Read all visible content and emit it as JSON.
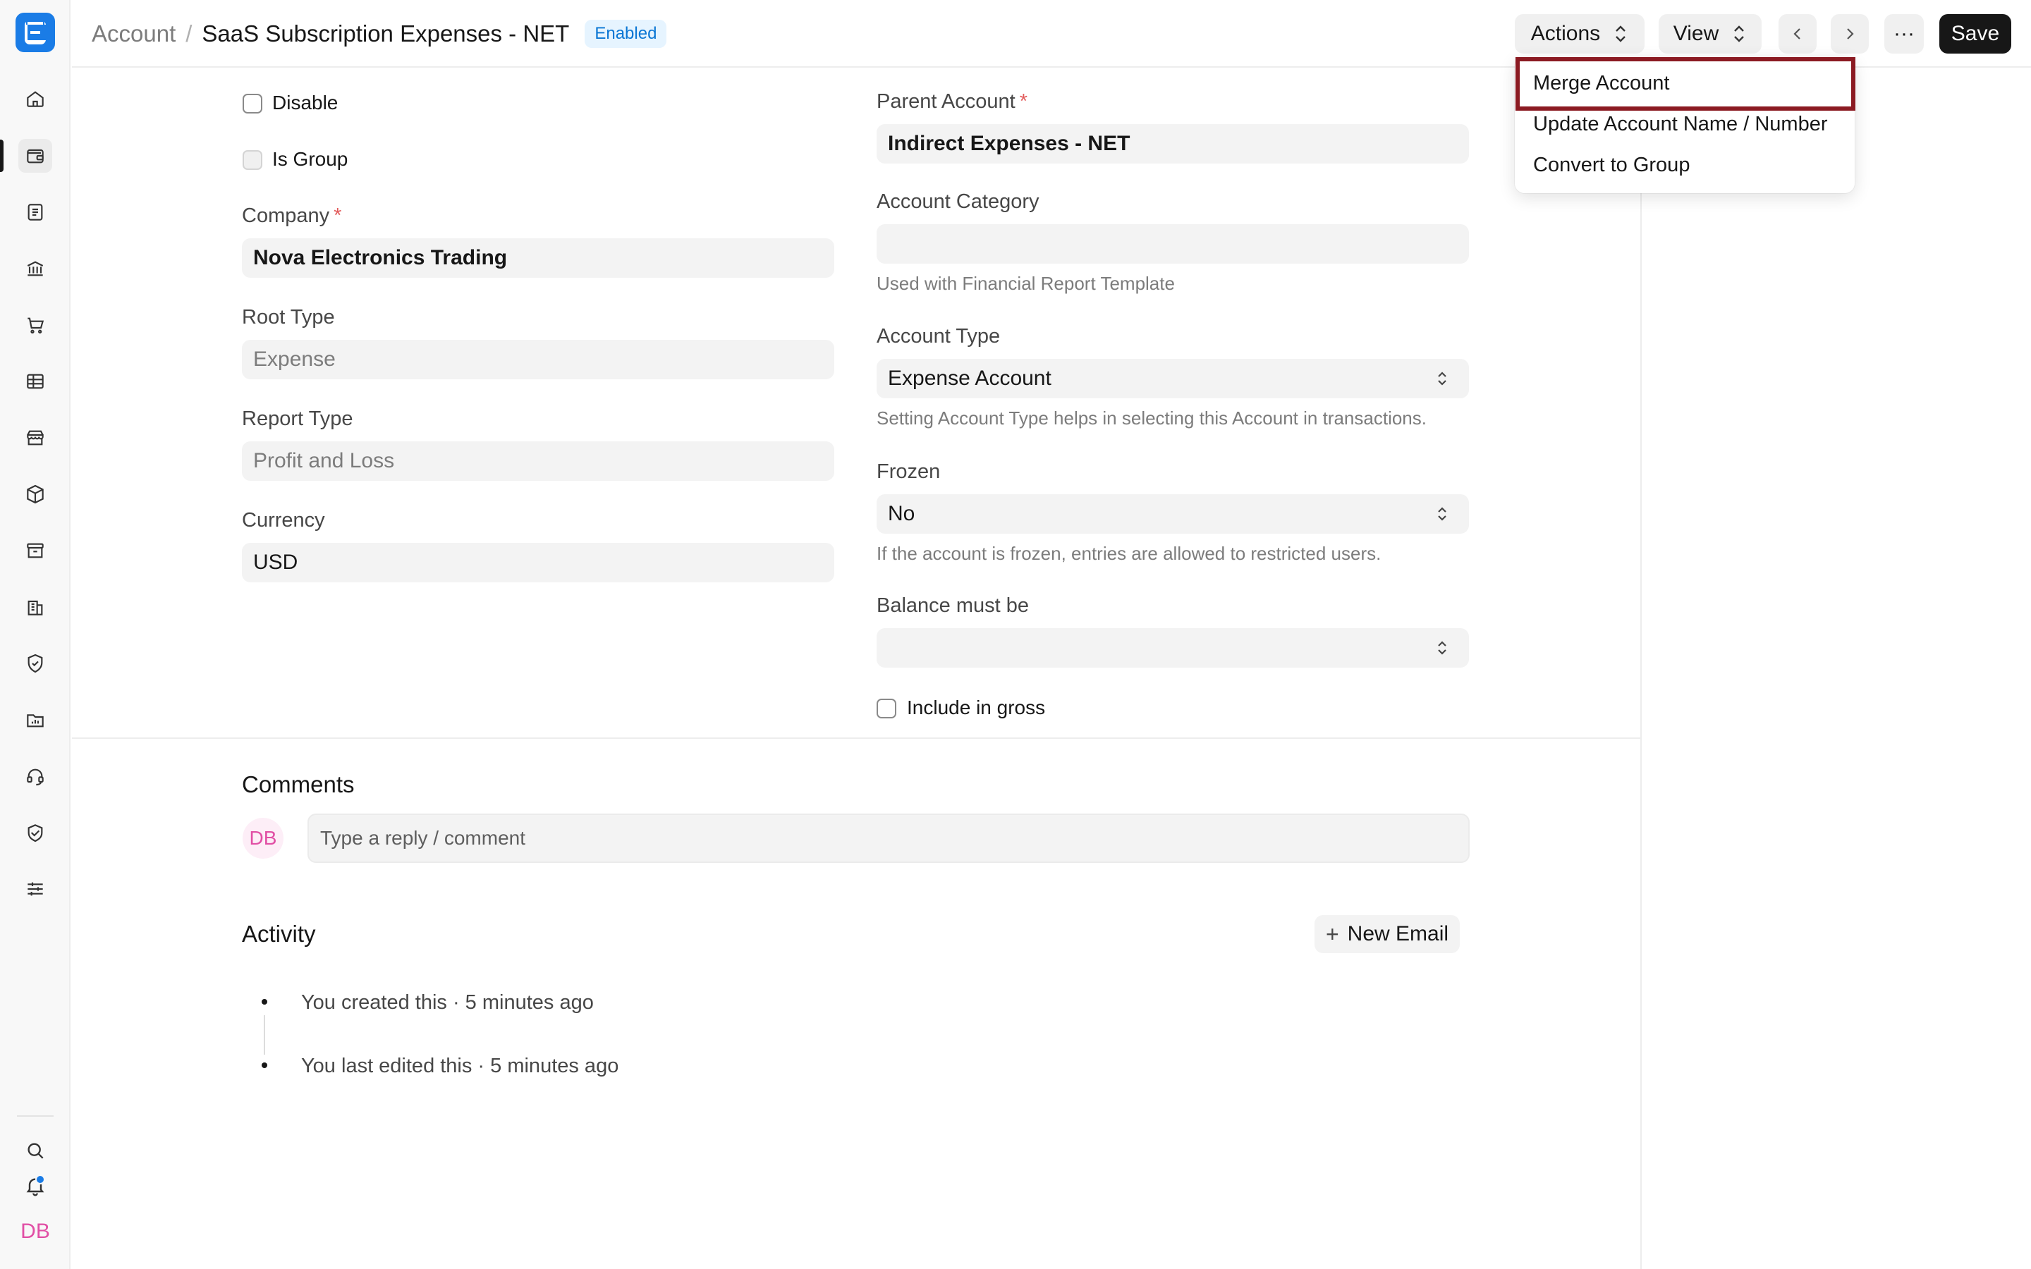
{
  "sidebar": {
    "logo_letter": "E",
    "avatar_initials": "DB",
    "icons": [
      "home-icon",
      "wallet-icon",
      "file-text-icon",
      "bank-icon",
      "cart-icon",
      "table-icon",
      "store-icon",
      "box-icon",
      "archive-icon",
      "building-icon",
      "shield-icon",
      "folder-chart-icon",
      "headset-icon",
      "handshake-icon",
      "sliders-icon",
      "search-icon",
      "bell-icon"
    ]
  },
  "header": {
    "breadcrumb_parent": "Account",
    "breadcrumb_sep": "/",
    "title": "SaaS Subscription Expenses - NET",
    "status_badge": "Enabled",
    "actions_label": "Actions",
    "view_label": "View",
    "more_label": "···",
    "save_label": "Save"
  },
  "actions_menu": {
    "items": [
      "Merge Account",
      "Update Account Name / Number",
      "Convert to Group"
    ],
    "highlighted_item": "Merge Account"
  },
  "form": {
    "disable_label": "Disable",
    "is_group_label": "Is Group",
    "company_label": "Company",
    "company_value": "Nova Electronics Trading",
    "root_type_label": "Root Type",
    "root_type_value": "Expense",
    "report_type_label": "Report Type",
    "report_type_value": "Profit and Loss",
    "currency_label": "Currency",
    "currency_value": "USD",
    "parent_account_label": "Parent Account",
    "parent_account_value": "Indirect Expenses - NET",
    "account_category_label": "Account Category",
    "account_category_value": "",
    "account_category_hint": "Used with Financial Report Template",
    "account_type_label": "Account Type",
    "account_type_value": "Expense Account",
    "account_type_hint": "Setting Account Type helps in selecting this Account in transactions.",
    "frozen_label": "Frozen",
    "frozen_value": "No",
    "frozen_hint": "If the account is frozen, entries are allowed to restricted users.",
    "balance_label": "Balance must be",
    "balance_value": "",
    "include_gross_label": "Include in gross",
    "required_mark": "*"
  },
  "comments": {
    "title": "Comments",
    "avatar_initials": "DB",
    "placeholder": "Type a reply / comment"
  },
  "activity": {
    "title": "Activity",
    "new_email_label": "New Email",
    "new_email_plus": "+",
    "items": [
      "You created this · 5 minutes ago",
      "You last edited this · 5 minutes ago"
    ]
  },
  "colors": {
    "accent": "#1a7ce6",
    "badge_text": "#0a76d4",
    "highlight_border": "#8b1a22",
    "avatar_pink": "#e14fa5"
  }
}
